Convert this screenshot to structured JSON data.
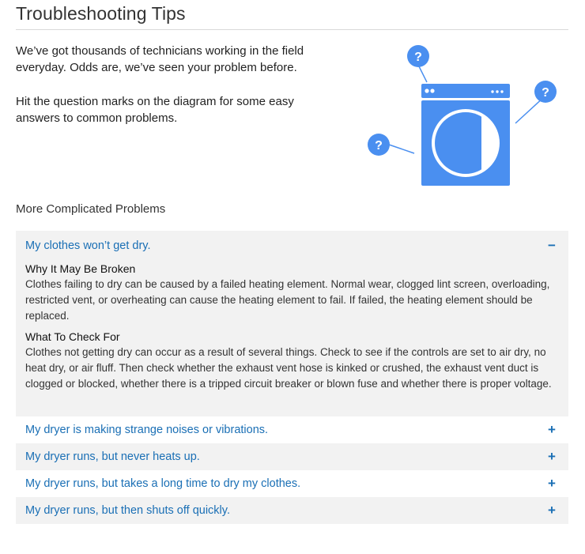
{
  "page": {
    "title": "Troubleshooting Tips",
    "intro_1": "We’ve got thousands of technicians working in the field everyday. Odds are, we’ve seen your problem before.",
    "intro_2": "Hit the question marks on the diagram for some easy answers to common problems."
  },
  "diagram": {
    "marker_label": "?",
    "accent_color": "#4a8ff0"
  },
  "section": {
    "heading": "More Complicated Problems"
  },
  "accordion": {
    "items": [
      {
        "question": "My clothes won’t get dry.",
        "toggle": "−",
        "expanded": true,
        "why_heading": "Why It May Be Broken",
        "why_text": "Clothes failing to dry can be caused by a failed heating element. Normal wear, clogged lint screen, overloading, restricted vent, or overheating can cause the heating element to fail. If failed, the heating element should be replaced.",
        "check_heading": "What To Check For",
        "check_text": "Clothes not getting dry can occur as a result of several things. Check to see if the controls are set to air dry, no heat dry, or air fluff. Then check whether the exhaust vent hose is kinked or crushed, the exhaust vent duct is clogged or blocked, whether there is a tripped circuit breaker or blown fuse and whether there is proper voltage."
      },
      {
        "question": "My dryer is making strange noises or vibrations.",
        "toggle": "+",
        "expanded": false
      },
      {
        "question": "My dryer runs, but never heats up.",
        "toggle": "+",
        "expanded": false
      },
      {
        "question": "My dryer runs, but takes a long time to dry my clothes.",
        "toggle": "+",
        "expanded": false
      },
      {
        "question": "My dryer runs, but then shuts off quickly.",
        "toggle": "+",
        "expanded": false
      }
    ]
  }
}
